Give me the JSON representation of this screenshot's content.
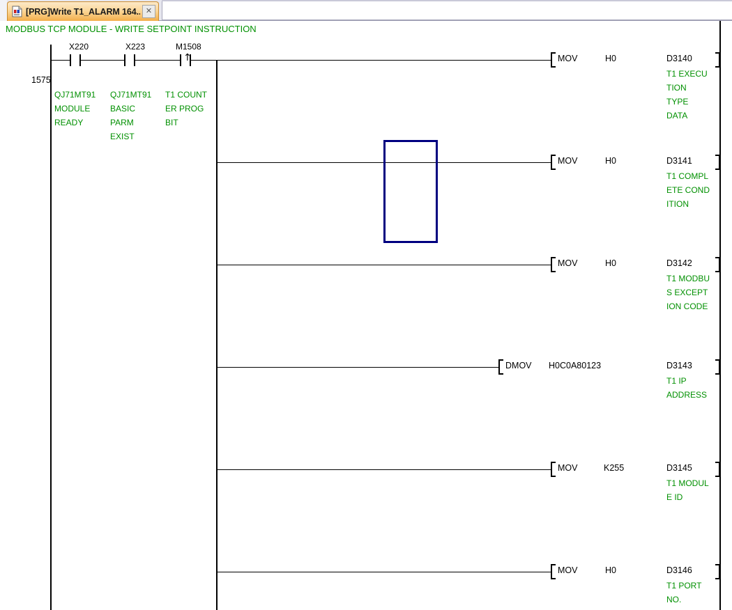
{
  "window": {
    "tab": {
      "icon": "ladder-program-icon",
      "title": "[PRG]Write T1_ALARM 164...",
      "close_label": "✕"
    }
  },
  "ladder": {
    "rung_comment": "MODBUS TCP MODULE - WRITE SETPOINT INSTRUCTION",
    "step_number": "1575",
    "contacts": [
      {
        "device": "X220",
        "type": "normally-open",
        "comment_lines": [
          "QJ71MT91",
          "MODULE",
          "READY"
        ]
      },
      {
        "device": "X223",
        "type": "normally-open",
        "comment_lines": [
          "QJ71MT91",
          "BASIC",
          "PARM",
          "EXIST"
        ]
      },
      {
        "device": "M1508",
        "type": "rising-edge-pulse",
        "arrow": "↑",
        "comment_lines": [
          "T1 COUNT",
          "ER PROG",
          "BIT"
        ]
      }
    ],
    "instructions": [
      {
        "op": "MOV",
        "source": "H0",
        "destination": "D3140",
        "comment_lines": [
          "T1 EXECU",
          "TION",
          "TYPE",
          "DATA"
        ]
      },
      {
        "op": "MOV",
        "source": "H0",
        "destination": "D3141",
        "comment_lines": [
          "T1 COMPL",
          "ETE COND",
          "ITION"
        ]
      },
      {
        "op": "MOV",
        "source": "H0",
        "destination": "D3142",
        "comment_lines": [
          "T1 MODBU",
          "S EXCEPT",
          "ION CODE"
        ]
      },
      {
        "op": "DMOV",
        "source": "H0C0A80123",
        "destination": "D3143",
        "comment_lines": [
          "T1 IP",
          "ADDRESS"
        ]
      },
      {
        "op": "MOV",
        "source": "K255",
        "destination": "D3145",
        "comment_lines": [
          "T1 MODUL",
          "E ID"
        ]
      },
      {
        "op": "MOV",
        "source": "H0",
        "destination": "D3146",
        "comment_lines": [
          "T1 PORT",
          "NO."
        ]
      }
    ],
    "colors": {
      "comment_text": "#009000",
      "ladder_line": "#000000",
      "selection_cursor": "#000080"
    }
  }
}
